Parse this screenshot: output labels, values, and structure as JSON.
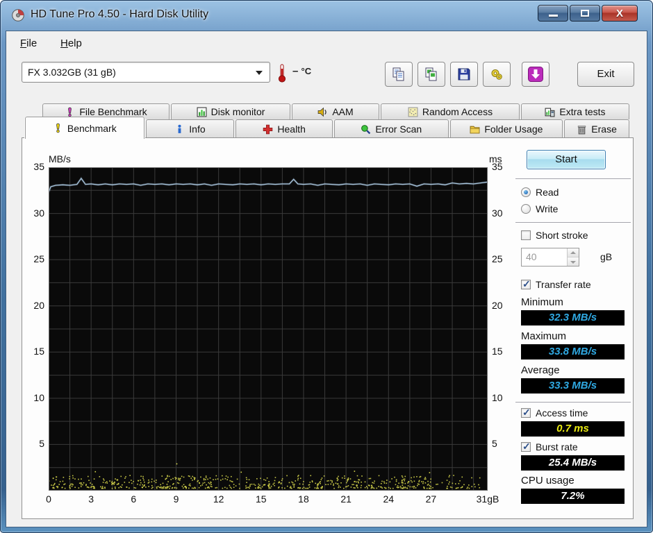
{
  "window": {
    "title": "HD Tune Pro 4.50 - Hard Disk Utility",
    "controls": [
      {
        "name": "minimize-button"
      },
      {
        "name": "maximize-button"
      },
      {
        "name": "close-button"
      }
    ]
  },
  "menu": {
    "file_label": "File",
    "help_label": "Help"
  },
  "toolbar": {
    "drive_selected": "FX 3.032GB (31 gB)",
    "temperature_value": "–",
    "temperature_unit": "°C",
    "temperature_icon": "thermometer-icon",
    "buttons": [
      {
        "icon": "copy-text-icon"
      },
      {
        "icon": "copy-image-icon"
      },
      {
        "icon": "save-icon"
      },
      {
        "icon": "options-icon"
      },
      {
        "icon": "update-icon"
      }
    ],
    "exit_label": "Exit"
  },
  "tabs": {
    "row1": [
      {
        "label": "File Benchmark",
        "icon": "file-benchmark-icon",
        "active": false
      },
      {
        "label": "Disk monitor",
        "icon": "disk-monitor-icon",
        "active": false
      },
      {
        "label": "AAM",
        "icon": "speaker-icon",
        "active": false
      },
      {
        "label": "Random Access",
        "icon": "random-access-icon",
        "active": false
      },
      {
        "label": "Extra tests",
        "icon": "extra-tests-icon",
        "active": false
      }
    ],
    "row2": [
      {
        "label": "Benchmark",
        "icon": "benchmark-icon",
        "active": true
      },
      {
        "label": "Info",
        "icon": "info-icon",
        "active": false
      },
      {
        "label": "Health",
        "icon": "health-icon",
        "active": false
      },
      {
        "label": "Error Scan",
        "icon": "error-scan-icon",
        "active": false
      },
      {
        "label": "Folder Usage",
        "icon": "folder-icon",
        "active": false
      },
      {
        "label": "Erase",
        "icon": "trash-icon",
        "active": false
      }
    ]
  },
  "benchmark_panel": {
    "start_label": "Start",
    "read_label": "Read",
    "write_label": "Write",
    "mode_selected": "Read",
    "short_stroke_label": "Short stroke",
    "short_stroke_checked": false,
    "short_stroke_value": "40",
    "short_stroke_unit": "gB",
    "transfer_rate_label": "Transfer rate",
    "transfer_rate_checked": true,
    "minimum_label": "Minimum",
    "minimum_value": "32.3 MB/s",
    "maximum_label": "Maximum",
    "maximum_value": "33.8 MB/s",
    "average_label": "Average",
    "average_value": "33.3 MB/s",
    "access_time_label": "Access time",
    "access_time_checked": true,
    "access_time_value": "0.7 ms",
    "burst_rate_label": "Burst rate",
    "burst_rate_checked": true,
    "burst_rate_value": "25.4 MB/s",
    "cpu_usage_label": "CPU usage",
    "cpu_usage_value": "7.2%",
    "value_colors": {
      "rate": "#2fa8e1",
      "access": "#e9ea12",
      "plain": "#ffffff"
    }
  },
  "chart_data": {
    "type": "line",
    "ylabel_left": "MB/s",
    "ylabel_right": "ms",
    "xlim": [
      0,
      31
    ],
    "ylim": [
      0,
      35
    ],
    "y_ticks": [
      35,
      30,
      25,
      20,
      15,
      10,
      5
    ],
    "x_ticks": [
      "0",
      "3",
      "6",
      "9",
      "12",
      "15",
      "18",
      "21",
      "24",
      "27",
      "31gB"
    ],
    "grid": {
      "x_step": 1.5,
      "y_step": 2.5,
      "color": "#3b3b3b",
      "border": "#6e6e6e"
    },
    "background": "#0a0a0a",
    "series": [
      {
        "name": "transfer-rate",
        "type": "line",
        "color": "#a9c6de",
        "points": [
          [
            0,
            32.3
          ],
          [
            0.15,
            32.9
          ],
          [
            0.5,
            33.05
          ],
          [
            1,
            33.1
          ],
          [
            1.5,
            33.05
          ],
          [
            2,
            33.15
          ],
          [
            2.3,
            33.8
          ],
          [
            2.6,
            33.15
          ],
          [
            3,
            33.2
          ],
          [
            3.5,
            33.1
          ],
          [
            4,
            33.2
          ],
          [
            4.5,
            33.1
          ],
          [
            5,
            33.2
          ],
          [
            5.5,
            33.15
          ],
          [
            6,
            33.2
          ],
          [
            6.5,
            33.05
          ],
          [
            7,
            33.2
          ],
          [
            7.5,
            33.15
          ],
          [
            8,
            33.2
          ],
          [
            8.5,
            33.1
          ],
          [
            9,
            33.2
          ],
          [
            9.5,
            33.15
          ],
          [
            10,
            33.2
          ],
          [
            10.5,
            33.1
          ],
          [
            11,
            33.2
          ],
          [
            11.5,
            33.05
          ],
          [
            12,
            33.2
          ],
          [
            12.5,
            33.15
          ],
          [
            13,
            33.1
          ],
          [
            13.5,
            33.2
          ],
          [
            14,
            33.15
          ],
          [
            14.5,
            33.2
          ],
          [
            15,
            33.1
          ],
          [
            15.5,
            33.2
          ],
          [
            16,
            33.15
          ],
          [
            16.5,
            33.2
          ],
          [
            17,
            33.2
          ],
          [
            17.3,
            33.7
          ],
          [
            17.6,
            33.2
          ],
          [
            18,
            33.15
          ],
          [
            18.5,
            33.2
          ],
          [
            19,
            33.05
          ],
          [
            19.5,
            33.2
          ],
          [
            20,
            33.15
          ],
          [
            20.5,
            33.1
          ],
          [
            21,
            33.2
          ],
          [
            21.5,
            33.15
          ],
          [
            22,
            33.2
          ],
          [
            22.5,
            33.05
          ],
          [
            23,
            33.2
          ],
          [
            23.5,
            33.15
          ],
          [
            24,
            33.1
          ],
          [
            24.5,
            33.2
          ],
          [
            25,
            33.15
          ],
          [
            25.5,
            33.2
          ],
          [
            26,
            32.95
          ],
          [
            26.5,
            33.2
          ],
          [
            27,
            33.15
          ],
          [
            27.5,
            33.2
          ],
          [
            28,
            33.1
          ],
          [
            28.5,
            33.3
          ],
          [
            29,
            33.2
          ],
          [
            29.5,
            33.25
          ],
          [
            30,
            33.2
          ],
          [
            30.5,
            33.3
          ],
          [
            31,
            33.4
          ]
        ]
      },
      {
        "name": "access-time",
        "type": "scatter",
        "color": "#d9d94d",
        "count": 650,
        "seed": 42,
        "x_range": [
          0,
          30.6
        ],
        "y_range": [
          0.25,
          1.65
        ],
        "thin_after_x": 27,
        "outliers": [
          [
            9.05,
            2.9
          ],
          [
            3.3,
            2.05
          ],
          [
            13.6,
            2.0
          ],
          [
            21.6,
            2.1
          ],
          [
            26.9,
            1.95
          ]
        ]
      }
    ]
  }
}
